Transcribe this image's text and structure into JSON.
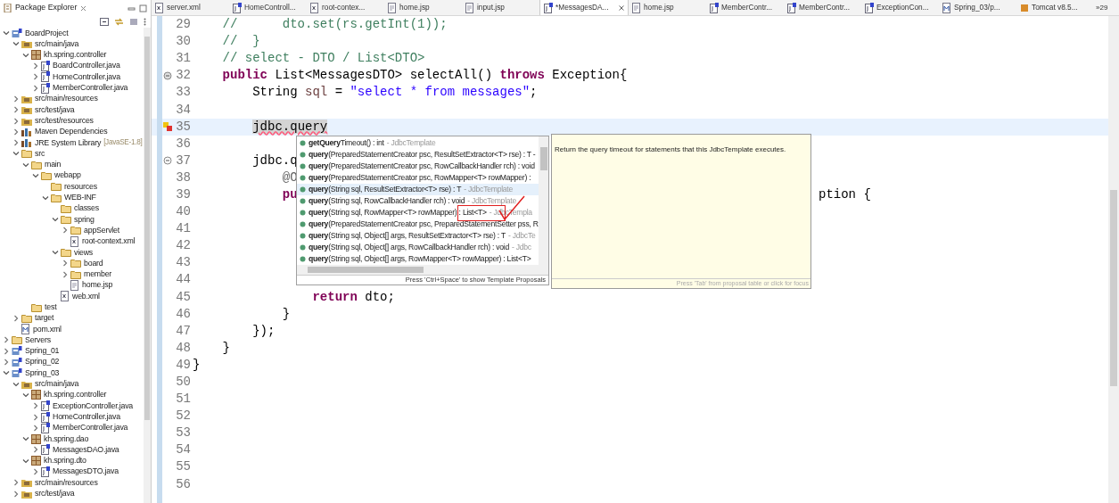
{
  "explorer": {
    "title": "Package Explorer",
    "tree": [
      {
        "label": "BoardProject",
        "kind": "project",
        "expanded": true,
        "children": [
          {
            "label": "src/main/java",
            "kind": "srcfolder",
            "expanded": true,
            "children": [
              {
                "label": "kh.spring.controller",
                "kind": "package",
                "expanded": true,
                "children": [
                  {
                    "label": "BoardController.java",
                    "kind": "java",
                    "expanded": false
                  },
                  {
                    "label": "HomeController.java",
                    "kind": "java",
                    "expanded": false
                  },
                  {
                    "label": "MemberController.java",
                    "kind": "java",
                    "expanded": false
                  }
                ]
              }
            ]
          },
          {
            "label": "src/main/resources",
            "kind": "srcfolder",
            "expanded": false
          },
          {
            "label": "src/test/java",
            "kind": "srcfolder",
            "expanded": false
          },
          {
            "label": "src/test/resources",
            "kind": "srcfolder",
            "expanded": false
          },
          {
            "label": "Maven Dependencies",
            "kind": "library",
            "expanded": false
          },
          {
            "label": "JRE System Library",
            "decoration": "[JavaSE-1.8]",
            "kind": "library",
            "expanded": false
          },
          {
            "label": "src",
            "kind": "folder",
            "expanded": true,
            "children": [
              {
                "label": "main",
                "kind": "folder",
                "expanded": true,
                "children": [
                  {
                    "label": "webapp",
                    "kind": "folder",
                    "expanded": true,
                    "children": [
                      {
                        "label": "resources",
                        "kind": "folder"
                      },
                      {
                        "label": "WEB-INF",
                        "kind": "folder",
                        "expanded": true,
                        "children": [
                          {
                            "label": "classes",
                            "kind": "folder"
                          },
                          {
                            "label": "spring",
                            "kind": "folder",
                            "expanded": true,
                            "children": [
                              {
                                "label": "appServlet",
                                "kind": "folder",
                                "expanded": false
                              },
                              {
                                "label": "root-context.xml",
                                "kind": "xml"
                              }
                            ]
                          },
                          {
                            "label": "views",
                            "kind": "folder",
                            "expanded": true,
                            "children": [
                              {
                                "label": "board",
                                "kind": "folder",
                                "expanded": false
                              },
                              {
                                "label": "member",
                                "kind": "folder",
                                "expanded": false
                              },
                              {
                                "label": "home.jsp",
                                "kind": "jsp"
                              }
                            ]
                          },
                          {
                            "label": "web.xml",
                            "kind": "xml"
                          }
                        ]
                      }
                    ]
                  }
                ]
              },
              {
                "label": "test",
                "kind": "folder"
              }
            ]
          },
          {
            "label": "target",
            "kind": "folder",
            "expanded": false
          },
          {
            "label": "pom.xml",
            "kind": "pom"
          }
        ]
      },
      {
        "label": "Servers",
        "kind": "folder",
        "expanded": false
      },
      {
        "label": "Spring_01",
        "kind": "project",
        "expanded": false
      },
      {
        "label": "Spring_02",
        "kind": "project",
        "expanded": false
      },
      {
        "label": "Spring_03",
        "kind": "project",
        "expanded": true,
        "children": [
          {
            "label": "src/main/java",
            "kind": "srcfolder",
            "expanded": true,
            "children": [
              {
                "label": "kh.spring.controller",
                "kind": "package",
                "expanded": true,
                "children": [
                  {
                    "label": "ExceptionController.java",
                    "kind": "java",
                    "expanded": false
                  },
                  {
                    "label": "HomeController.java",
                    "kind": "java",
                    "expanded": false
                  },
                  {
                    "label": "MemberController.java",
                    "kind": "java",
                    "expanded": false
                  }
                ]
              },
              {
                "label": "kh.spring.dao",
                "kind": "package",
                "expanded": true,
                "children": [
                  {
                    "label": "MessagesDAO.java",
                    "kind": "java",
                    "expanded": false
                  }
                ]
              },
              {
                "label": "kh.spring.dto",
                "kind": "package",
                "expanded": true,
                "children": [
                  {
                    "label": "MessagesDTO.java",
                    "kind": "java",
                    "expanded": false
                  }
                ]
              }
            ]
          },
          {
            "label": "src/main/resources",
            "kind": "srcfolder",
            "expanded": false
          },
          {
            "label": "src/test/java",
            "kind": "srcfolder",
            "expanded": false
          }
        ]
      }
    ]
  },
  "tabs": [
    {
      "label": "server.xml",
      "kind": "xml",
      "selected": false
    },
    {
      "label": "HomeControll...",
      "kind": "java",
      "selected": false
    },
    {
      "label": "root-contex...",
      "kind": "xml",
      "selected": false
    },
    {
      "label": "home.jsp",
      "kind": "jsp",
      "selected": false
    },
    {
      "label": "input.jsp",
      "kind": "jsp",
      "selected": false
    },
    {
      "label": "*MessagesDA...",
      "kind": "java",
      "selected": true
    },
    {
      "label": "home.jsp",
      "kind": "jsp",
      "selected": false
    },
    {
      "label": "MemberContr...",
      "kind": "java",
      "selected": false
    },
    {
      "label": "MemberContr...",
      "kind": "java",
      "selected": false
    },
    {
      "label": "ExceptionCon...",
      "kind": "java",
      "selected": false
    },
    {
      "label": "Spring_03/p...",
      "kind": "pom",
      "selected": false
    },
    {
      "label": "Tomcat v8.5...",
      "kind": "server",
      "selected": false
    }
  ],
  "more_tabs": "»29",
  "code": [
    {
      "number": "29",
      "kind": "plain",
      "segments": [
        {
          "text": "    //      dto.set(rs.getInt(1));",
          "kind": "comment"
        }
      ]
    },
    {
      "number": "30",
      "kind": "plain",
      "segments": [
        {
          "text": "    //  }",
          "kind": "comment"
        }
      ]
    },
    {
      "number": "31",
      "kind": "plain",
      "segments": [
        {
          "text": "    // select - DTO / List<DTO>",
          "kind": "comment"
        }
      ]
    },
    {
      "number": "32",
      "kind": "override",
      "segments": [
        {
          "text": "    public",
          "kind": "keyword"
        },
        {
          "text": " List<MessagesDTO> selectAll() ",
          "kind": "plain"
        },
        {
          "text": "throws",
          "kind": "keyword"
        },
        {
          "text": " Exception{",
          "kind": "plain"
        }
      ]
    },
    {
      "number": "33",
      "kind": "plain",
      "segments": [
        {
          "text": "        String ",
          "kind": "plain"
        },
        {
          "text": "sql",
          "kind": "local"
        },
        {
          "text": " = ",
          "kind": "plain"
        },
        {
          "text": "\"select * from messages\"",
          "kind": "string"
        },
        {
          "text": ";",
          "kind": "plain"
        }
      ]
    },
    {
      "number": "34",
      "kind": "plain"
    },
    {
      "number": "35",
      "kind": "error",
      "current": true,
      "segments": [
        {
          "text": "        jdbc.query",
          "kind": "marked"
        }
      ]
    },
    {
      "number": "36",
      "kind": "plain",
      "current": false
    },
    {
      "number": "37",
      "kind": "fold",
      "segments": [
        {
          "text": "        jdbc.q",
          "kind": "plain"
        }
      ]
    },
    {
      "number": "38",
      "kind": "plain",
      "segments": [
        {
          "text": "            @O",
          "kind": "annotation"
        }
      ]
    },
    {
      "number": "39",
      "kind": "plain",
      "segments": [
        {
          "text": "            pu",
          "kind": "keyword"
        }
      ],
      "tail": "ption {"
    },
    {
      "number": "40",
      "kind": "plain"
    },
    {
      "number": "41",
      "kind": "plain"
    },
    {
      "number": "42",
      "kind": "plain"
    },
    {
      "number": "43",
      "kind": "plain"
    },
    {
      "number": "44",
      "kind": "plain"
    },
    {
      "number": "45",
      "kind": "plain",
      "segments": [
        {
          "text": "                return",
          "kind": "keyword"
        },
        {
          "text": " dto;",
          "kind": "plain"
        }
      ]
    },
    {
      "number": "46",
      "kind": "plain",
      "segments": [
        {
          "text": "            }",
          "kind": "plain"
        }
      ]
    },
    {
      "number": "47",
      "kind": "plain",
      "segments": [
        {
          "text": "        });",
          "kind": "plain"
        }
      ]
    },
    {
      "number": "48",
      "kind": "plain",
      "segments": [
        {
          "text": "    }",
          "kind": "plain"
        }
      ]
    },
    {
      "number": "49",
      "kind": "plain",
      "segments": [
        {
          "text": "}",
          "kind": "plain"
        }
      ]
    },
    {
      "number": "50",
      "kind": "plain"
    },
    {
      "number": "51",
      "kind": "plain"
    },
    {
      "number": "52",
      "kind": "plain"
    },
    {
      "number": "53",
      "kind": "plain"
    },
    {
      "number": "54",
      "kind": "plain"
    },
    {
      "number": "55",
      "kind": "plain"
    },
    {
      "number": "56",
      "kind": "plain"
    }
  ],
  "proposals": {
    "items": [
      {
        "text": "**getQuery**Timeout() : int",
        "owner": "- JdbcTemplate",
        "selected": false
      },
      {
        "text": "**query**(PreparedStatementCreator psc, ResultSetExtractor<T> rse) : T -",
        "selected": false
      },
      {
        "text": "**query**(PreparedStatementCreator psc, RowCallbackHandler rch) : void",
        "selected": false
      },
      {
        "text": "**query**(PreparedStatementCreator psc, RowMapper<T> rowMapper) :",
        "selected": false
      },
      {
        "text": "**query**(String sql, ResultSetExtractor<T> rse) : T",
        "owner": "- JdbcTemplate",
        "selected": true
      },
      {
        "text": "**query**(String sql, RowCallbackHandler rch) : void",
        "owner": "- JdbcTemplate",
        "selected": false
      },
      {
        "text": "**query**(String sql, RowMapper<T> rowMapper) : List<T>",
        "owner": "- JdbcTempla",
        "selected": false
      },
      {
        "text": "**query**(PreparedStatementCreator psc, PreparedStatementSetter pss, R",
        "selected": false
      },
      {
        "text": "**query**(String sql, Object[] args, ResultSetExtractor<T> rse) : T",
        "owner": "- JdbcTe",
        "selected": false
      },
      {
        "text": "**query**(String sql, Object[] args, RowCallbackHandler rch) : void",
        "owner": "- Jdbc",
        "selected": false
      },
      {
        "text": "**query**(String sql, Object[] args, RowMapper<T> rowMapper) : List<T>",
        "selected": false
      }
    ],
    "footer": "Press 'Ctrl+Space' to show Template Proposals"
  },
  "doc": {
    "text": "Return the query timeout for statements that this JdbcTemplate executes.",
    "footer": "Press 'Tab' from proposal table or click for focus"
  }
}
